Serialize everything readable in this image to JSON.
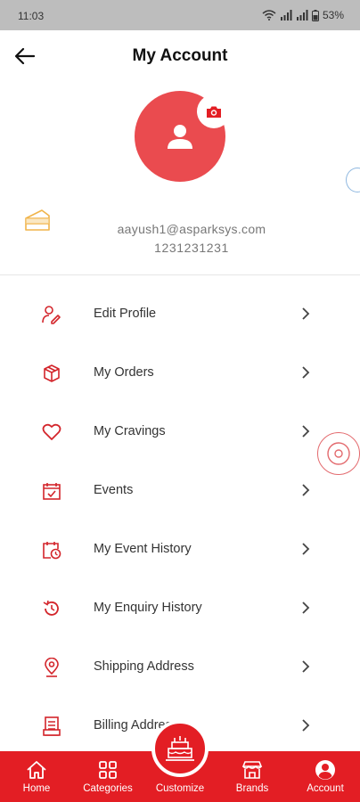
{
  "status_bar": {
    "time": "11:03",
    "battery": "53%"
  },
  "header": {
    "title": "My Account"
  },
  "profile": {
    "email": "aayush1@asparksys.com",
    "phone": "1231231231"
  },
  "menu": {
    "items": [
      {
        "label": "Edit Profile",
        "icon": "edit-profile-icon"
      },
      {
        "label": "My Orders",
        "icon": "box-icon"
      },
      {
        "label": "My Cravings",
        "icon": "heart-icon"
      },
      {
        "label": "Events",
        "icon": "calendar-check-icon"
      },
      {
        "label": "My Event History",
        "icon": "calendar-clock-icon"
      },
      {
        "label": "My Enquiry History",
        "icon": "history-icon"
      },
      {
        "label": "Shipping Address",
        "icon": "location-pin-icon"
      },
      {
        "label": "Billing Address",
        "icon": "receipt-icon"
      }
    ]
  },
  "bottom_nav": {
    "items": [
      {
        "label": "Home",
        "icon": "home-icon"
      },
      {
        "label": "Categories",
        "icon": "grid-icon"
      },
      {
        "label": "Customize",
        "icon": "cake-icon"
      },
      {
        "label": "Brands",
        "icon": "store-icon"
      },
      {
        "label": "Account",
        "icon": "account-icon"
      }
    ]
  },
  "colors": {
    "accent": "#e31e24",
    "avatar_bg": "#ea4b4f",
    "status_bar": "#bdbdbd",
    "cake_yellow": "#f0b44a"
  }
}
